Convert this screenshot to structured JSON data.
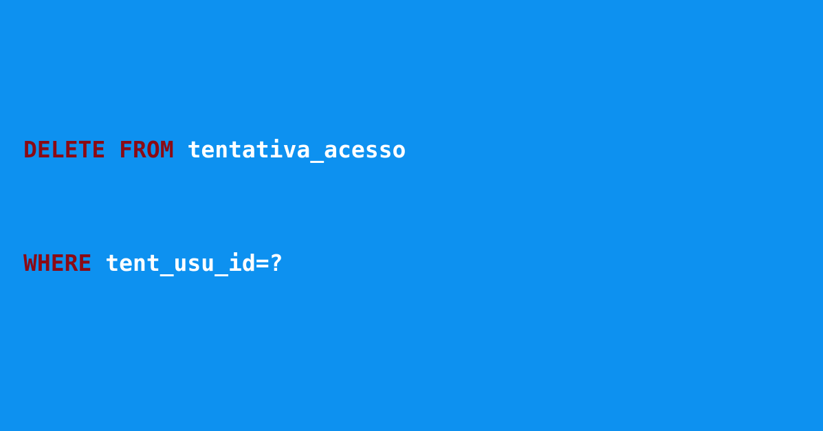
{
  "background_color": "#0d91f0",
  "keyword_color": "#8b0a14",
  "text_color": "#ffffff",
  "code": {
    "line1": {
      "keyword1": "DELETE",
      "keyword2": "FROM",
      "table": "tentativa_acesso"
    },
    "line2": {
      "keyword": "WHERE",
      "condition": "tent_usu_id=?"
    }
  }
}
